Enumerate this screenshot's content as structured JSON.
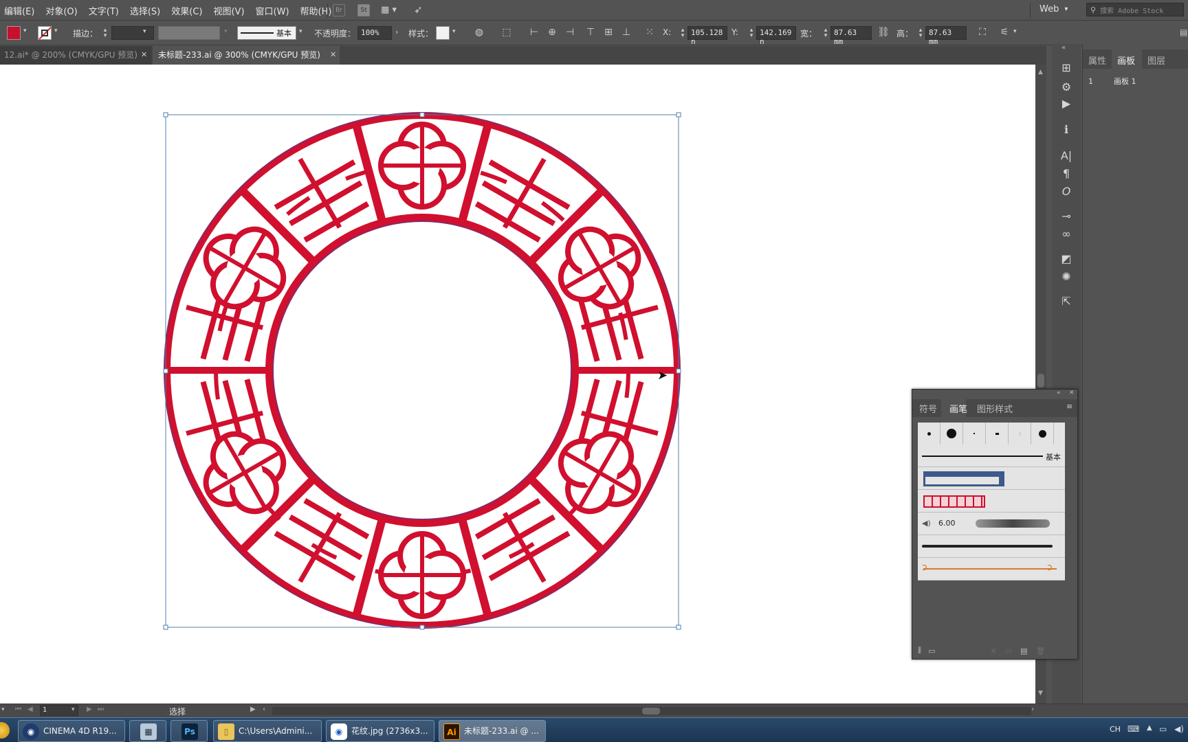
{
  "menu": {
    "items": [
      "编辑(E)",
      "对象(O)",
      "文字(T)",
      "选择(S)",
      "效果(C)",
      "视图(V)",
      "窗口(W)",
      "帮助(H)"
    ],
    "bridge_icon": "Br",
    "stock_icon": "St",
    "workspace": "Web",
    "search_placeholder": "搜索 Adobe Stock"
  },
  "control": {
    "fill_color": "#c8102e",
    "stroke_label": "描边：",
    "stroke_profile": "基本",
    "opacity_label": "不透明度：",
    "opacity_value": "100%",
    "style_label": "样式：",
    "x_label": "X:",
    "x_value": "105.128 n",
    "y_label": "Y:",
    "y_value": "142.169 n",
    "w_label": "宽：",
    "w_value": "87.63 mm",
    "h_label": "高：",
    "h_value": "87.63 mm"
  },
  "tabs": [
    {
      "label": "12.ai* @ 200% (CMYK/GPU 预览)",
      "active": false
    },
    {
      "label": "未标题-233.ai @ 300% (CMYK/GPU 预览)",
      "active": true
    }
  ],
  "right_panel": {
    "tabs": [
      "属性",
      "画板",
      "图层"
    ],
    "artboard_index": "1",
    "artboard_name": "画板 1"
  },
  "brush_panel": {
    "tabs": [
      "符号",
      "画笔",
      "图形样式"
    ],
    "basic_label": "基本",
    "brush_size": "6.00"
  },
  "status": {
    "page": "1",
    "tool": "选择"
  },
  "taskbar": {
    "items": [
      {
        "label": "CINEMA 4D R19...",
        "icon": "cinema4d-icon"
      },
      {
        "label": "",
        "icon": "calculator-icon"
      },
      {
        "label": "",
        "icon": "photoshop-icon"
      },
      {
        "label": "C:\\Users\\Admini...",
        "icon": "folder-icon"
      },
      {
        "label": "花纹.jpg (2736x3...",
        "icon": "image-viewer-icon"
      },
      {
        "label": "未标题-233.ai @ ...",
        "icon": "illustrator-icon"
      }
    ],
    "lang": "CH"
  },
  "colors": {
    "pattern_red": "#d0102e",
    "pattern_stroke": "#5a3a8a",
    "selection_blue": "#4f7ea8"
  }
}
